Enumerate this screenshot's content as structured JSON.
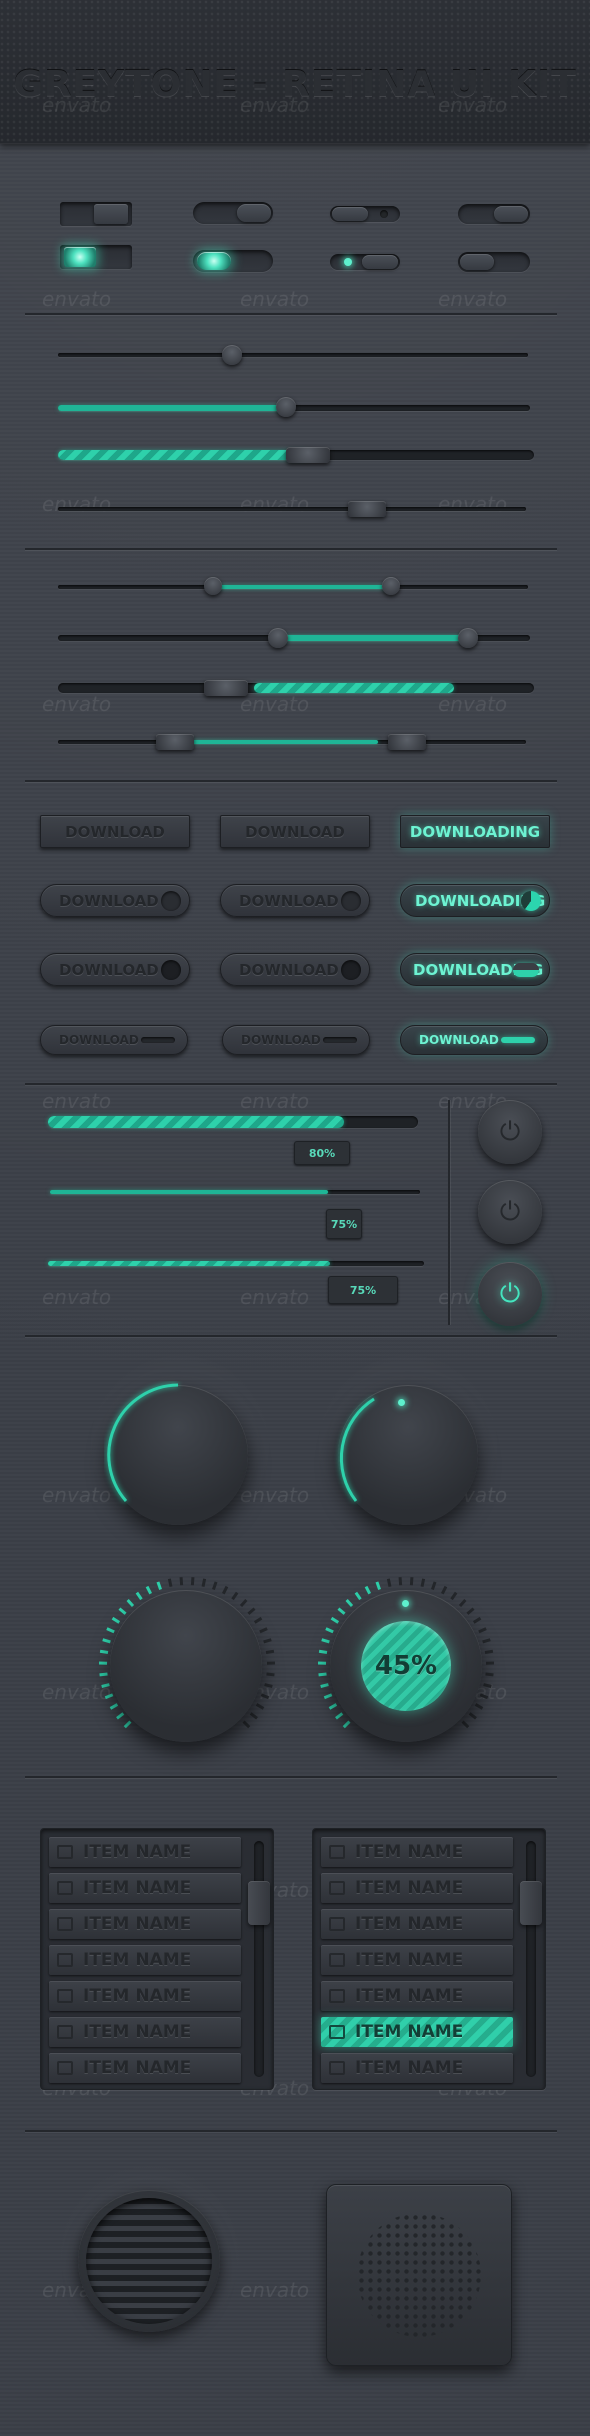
{
  "header": {
    "title": "GREYTONE - RETINA UI KIT"
  },
  "watermark": {
    "text": "envato"
  },
  "download_buttons": {
    "row1": [
      "DOWNLOAD",
      "DOWNLOAD",
      "DOWNLOADING"
    ],
    "row2": [
      "DOWNLOAD",
      "DOWNLOAD",
      "DOWNLOADING"
    ],
    "row3": [
      "DOWNLOAD",
      "DOWNLOAD",
      "DOWNLOADING"
    ],
    "row4": [
      "DOWNLOAD",
      "DOWNLOAD",
      "DOWNLOAD"
    ]
  },
  "progress": {
    "values": [
      0.8,
      0.75,
      0.75
    ],
    "labels": [
      "80%",
      "75%",
      "75%"
    ]
  },
  "knobs": {
    "percent_label": "45%",
    "percent_value": 0.45
  },
  "list_left": {
    "items": [
      "ITEM NAME",
      "ITEM NAME",
      "ITEM NAME",
      "ITEM NAME",
      "ITEM NAME",
      "ITEM NAME",
      "ITEM NAME"
    ]
  },
  "list_right": {
    "items": [
      "ITEM NAME",
      "ITEM NAME",
      "ITEM NAME",
      "ITEM NAME",
      "ITEM NAME",
      "ITEM NAME",
      "ITEM NAME"
    ],
    "selected_index": 5
  },
  "icons": {
    "power": "power-icon",
    "list_item": "square-icon"
  },
  "colors": {
    "accent": "#2ed1ab",
    "background": "#3b3f47"
  }
}
